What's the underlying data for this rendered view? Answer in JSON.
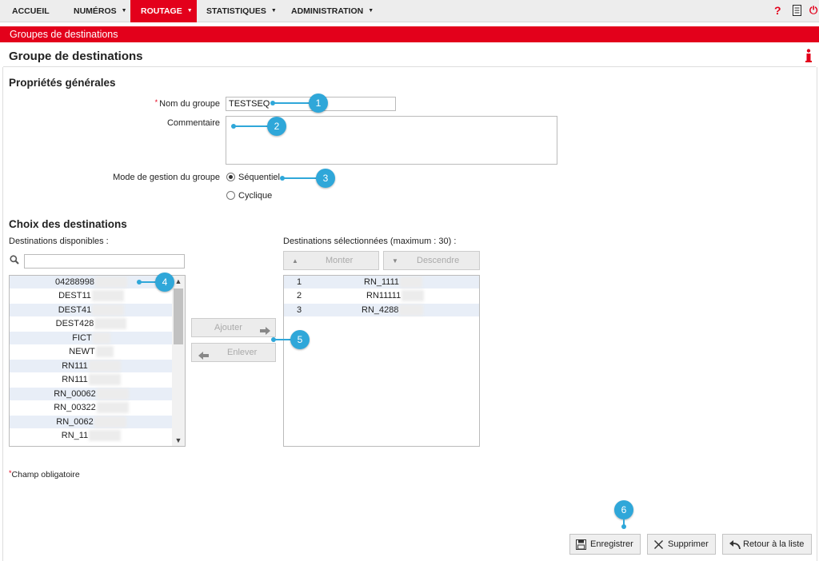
{
  "nav": {
    "items": [
      {
        "label": "ACCUEIL",
        "caret": ""
      },
      {
        "label": "NUMÉROS",
        "caret": "▼"
      },
      {
        "label": "ROUTAGE",
        "caret": "▼"
      },
      {
        "label": "STATISTIQUES",
        "caret": "▼"
      },
      {
        "label": "ADMINISTRATION",
        "caret": "▼"
      }
    ],
    "active": "ROUTAGE",
    "help_glyph": "?",
    "power_glyph": "⏻"
  },
  "breadcrumb": "Groupes de destinations",
  "page_title": "Groupe de destinations",
  "general": {
    "title": "Propriétés générales",
    "required_mark": "*",
    "name_label": "Nom du groupe",
    "name_value": "TESTSEQ",
    "comment_label": "Commentaire",
    "comment_value": "",
    "mode_label": "Mode de gestion du groupe",
    "mode_options": [
      "Séquentiel",
      "Cyclique"
    ],
    "mode_selected": "Séquentiel"
  },
  "destinations": {
    "title": "Choix des destinations",
    "available_label": "Destinations disponibles :",
    "search_value": "",
    "available": [
      "04288998",
      "DEST11",
      "DEST41",
      "DEST428",
      "FICT",
      "NEWT",
      "RN111",
      "RN111",
      "RN_00062",
      "RN_00322",
      "RN_0062",
      "RN_11"
    ],
    "selected_label": "Destinations sélectionnées (maximum : 30) :",
    "selected": [
      {
        "index": "1",
        "value": "RN_1111"
      },
      {
        "index": "2",
        "value": "RN11111"
      },
      {
        "index": "3",
        "value": "RN_4288"
      }
    ],
    "btn_up": "Monter",
    "btn_down": "Descendre",
    "btn_add": "Ajouter",
    "btn_remove": "Enlever"
  },
  "required_note_mark": "*",
  "required_note": "Champ obligatoire",
  "footer": {
    "save": "Enregistrer",
    "delete": "Supprimer",
    "back": "Retour à la liste"
  },
  "callouts": [
    "1",
    "2",
    "3",
    "4",
    "5",
    "6"
  ],
  "colors": {
    "brand_red": "#e3001b",
    "callout_blue": "#2fa7d9",
    "row_alt": "#e8eef7"
  }
}
